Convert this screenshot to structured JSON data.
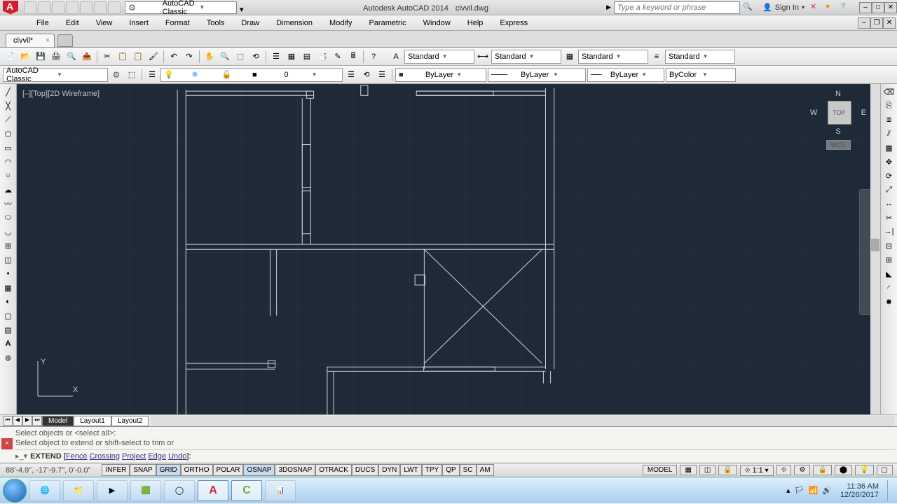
{
  "app": {
    "title_prefix": "Autodesk AutoCAD 2014",
    "filename": "civvil.dwg"
  },
  "workspace_selector": "AutoCAD Classic",
  "search_placeholder": "Type a keyword or phrase",
  "signin": "Sign In",
  "menus": [
    "File",
    "Edit",
    "View",
    "Insert",
    "Format",
    "Tools",
    "Draw",
    "Dimension",
    "Modify",
    "Parametric",
    "Window",
    "Help",
    "Express"
  ],
  "file_tab": {
    "name": "civvil*"
  },
  "ribbon2": {
    "style1": "Standard",
    "style2": "Standard",
    "style3": "Standard",
    "style4": "Standard"
  },
  "ribbon3": {
    "workspace": "AutoCAD Classic",
    "layer": "0",
    "prop1": "ByLayer",
    "prop2": "ByLayer",
    "prop3": "ByLayer",
    "prop4": "ByColor"
  },
  "viewport_label": "[–][Top][2D Wireframe]",
  "viewcube": {
    "n": "N",
    "s": "S",
    "e": "E",
    "w": "W",
    "face": "TOP",
    "wcs": "WCS"
  },
  "layout_tabs": {
    "model": "Model",
    "l1": "Layout1",
    "l2": "Layout2"
  },
  "command": {
    "hist1": "Select objects or <select all>:",
    "hist2": "Select object to extend or shift-select to trim or",
    "cmd": "EXTEND",
    "opts": [
      "Fence",
      "Crossing",
      "Project",
      "Edge",
      "Undo"
    ]
  },
  "status": {
    "coords": "88'-4.9\",  -17'-9.7\",  0'-0.0\"",
    "toggles": [
      "INFER",
      "SNAP",
      "GRID",
      "ORTHO",
      "POLAR",
      "OSNAP",
      "3DOSNAP",
      "OTRACK",
      "DUCS",
      "DYN",
      "LWT",
      "TPY",
      "QP",
      "SC",
      "AM"
    ],
    "toggles_on": [
      2,
      5
    ],
    "model": "MODEL",
    "scale": "1:1"
  },
  "clock": {
    "time": "11:36 AM",
    "date": "12/26/2017"
  }
}
